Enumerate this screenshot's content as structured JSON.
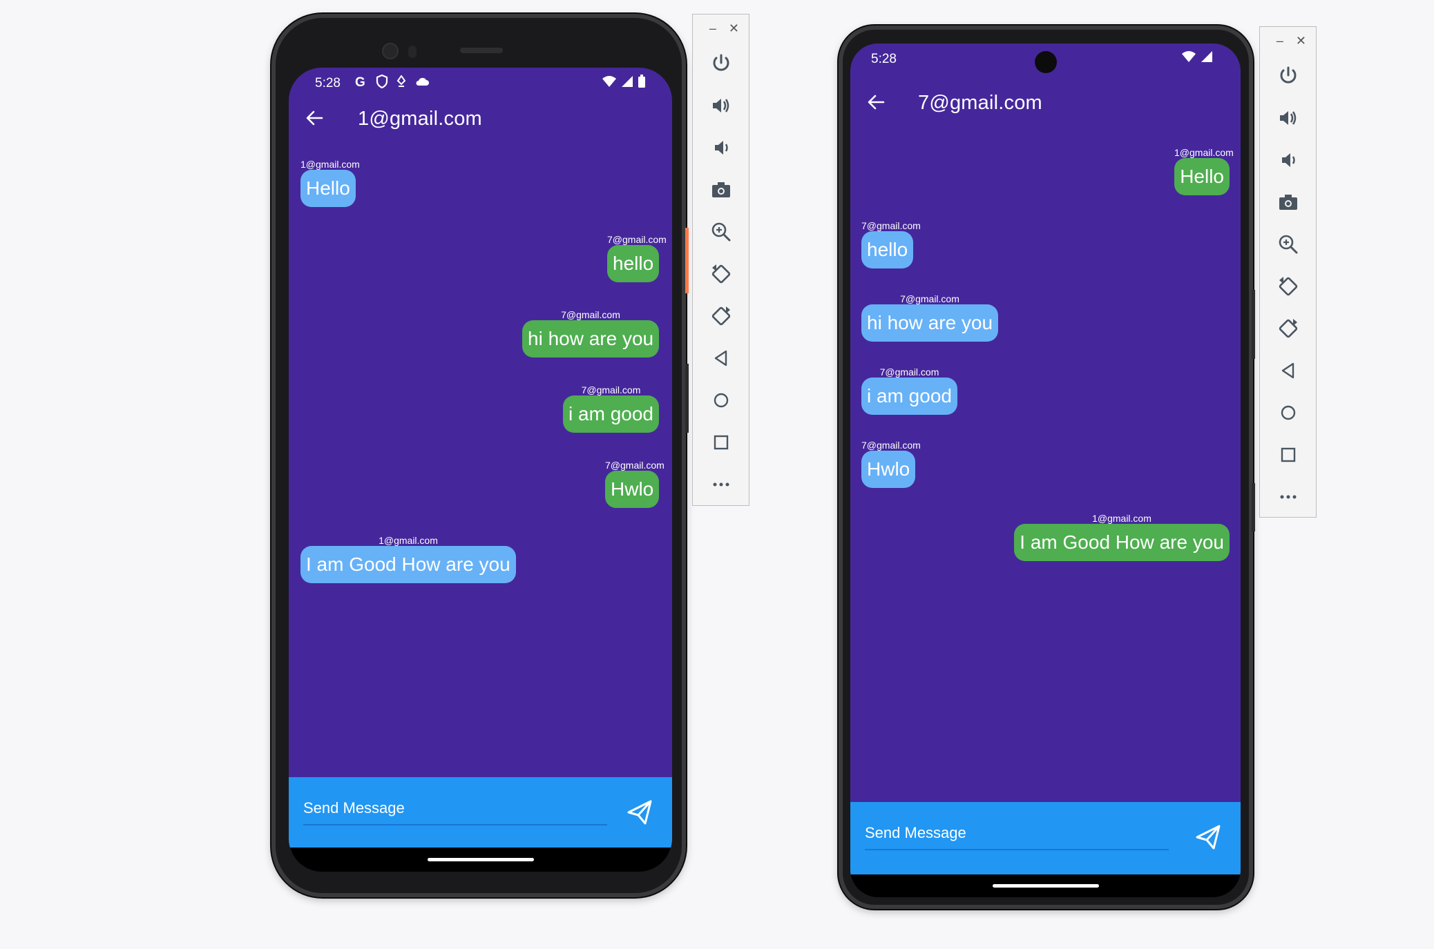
{
  "emulator_toolbar": {
    "minimize_label": "–",
    "close_label": "✕",
    "buttons": [
      "power-icon",
      "volume-up-icon",
      "volume-down-icon",
      "camera-icon",
      "zoom-in-icon",
      "rotate-left-icon",
      "rotate-right-icon",
      "back-triangle-icon",
      "home-circle-icon",
      "overview-square-icon",
      "more-icon"
    ]
  },
  "phone1": {
    "status_time": "5:28",
    "title": "1@gmail.com",
    "messages": [
      {
        "sender": "1@gmail.com",
        "text": "Hello",
        "color": "#67b1f7",
        "align": "left"
      },
      {
        "sender": "7@gmail.com",
        "text": "hello",
        "color": "#4fae50",
        "align": "right"
      },
      {
        "sender": "7@gmail.com",
        "text": "hi how are you",
        "color": "#4fae50",
        "align": "right"
      },
      {
        "sender": "7@gmail.com",
        "text": "i am good",
        "color": "#4fae50",
        "align": "right"
      },
      {
        "sender": "7@gmail.com",
        "text": "Hwlo",
        "color": "#4fae50",
        "align": "right"
      },
      {
        "sender": "1@gmail.com",
        "text": "I am Good How are you",
        "color": "#67b1f7",
        "align": "left"
      }
    ],
    "input_placeholder": "Send Message"
  },
  "phone2": {
    "status_time": "5:28",
    "title": "7@gmail.com",
    "messages": [
      {
        "sender": "1@gmail.com",
        "text": "Hello",
        "color": "#4fae50",
        "align": "right"
      },
      {
        "sender": "7@gmail.com",
        "text": "hello",
        "color": "#67b1f7",
        "align": "left"
      },
      {
        "sender": "7@gmail.com",
        "text": "hi how are you",
        "color": "#67b1f7",
        "align": "left"
      },
      {
        "sender": "7@gmail.com",
        "text": "i am good",
        "color": "#67b1f7",
        "align": "left"
      },
      {
        "sender": "7@gmail.com",
        "text": "Hwlo",
        "color": "#67b1f7",
        "align": "left"
      },
      {
        "sender": "1@gmail.com",
        "text": "I am Good How are you",
        "color": "#4fae50",
        "align": "right"
      }
    ],
    "input_placeholder": "Send Message"
  },
  "colors": {
    "chat_background": "#45279b",
    "send_bar": "#2196f3",
    "bubble_blue": "#67b1f7",
    "bubble_green": "#4fae50"
  }
}
